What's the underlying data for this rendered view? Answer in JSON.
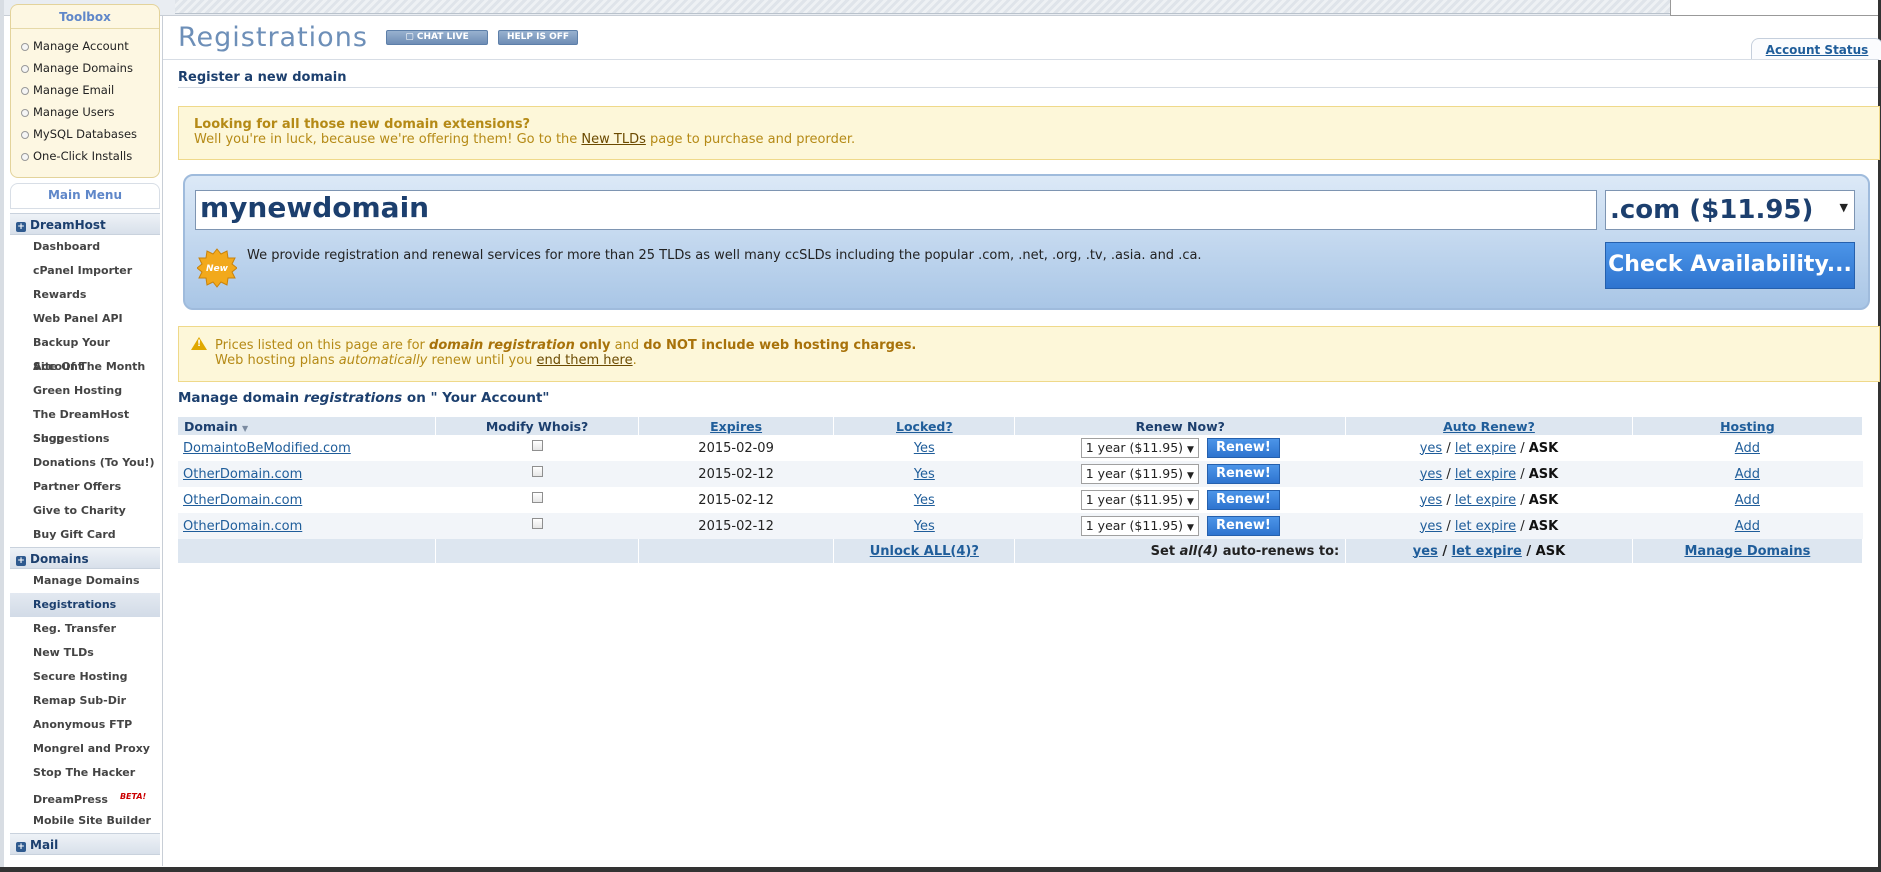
{
  "sidebar": {
    "toolbox_title": "Toolbox",
    "toolbox_items": [
      "Manage Account",
      "Manage Domains",
      "Manage Email",
      "Manage Users",
      "MySQL Databases",
      "One-Click Installs"
    ],
    "main_menu_title": "Main Menu",
    "sections": [
      {
        "title": "DreamHost",
        "items": [
          "Dashboard",
          "cPanel Importer",
          "Rewards",
          "Web Panel API",
          "Backup Your Account",
          "Site Of The Month",
          "Green Hosting",
          "The DreamHost Shop",
          "Suggestions",
          "Donations (To You!)",
          "Partner Offers",
          "Give to Charity",
          "Buy Gift Card"
        ]
      },
      {
        "title": "Domains",
        "items": [
          "Manage Domains",
          "Registrations",
          "Reg. Transfer",
          "New TLDs",
          "Secure Hosting",
          "Remap Sub-Dir",
          "Anonymous FTP",
          "Mongrel and Proxy",
          "Stop The Hacker",
          "DreamPress",
          "Mobile Site Builder"
        ]
      },
      {
        "title": "Mail",
        "items": []
      }
    ],
    "active_item": "Registrations",
    "beta_label": "BETA!"
  },
  "header": {
    "title": "Registrations",
    "chat_label": "CHAT LIVE",
    "help_label": "HELP IS OFF",
    "account_status": "Account Status"
  },
  "register": {
    "heading": "Register a new domain",
    "notice_title": "Looking for all those new domain extensions?",
    "notice_pre": "Well you're in luck, because we're offering them! Go to the ",
    "notice_link": "New TLDs",
    "notice_post": " page to purchase and preorder.",
    "domain_value": "mynewdomain",
    "tld_selected": ".com ($11.95)",
    "new_badge": "New",
    "blurb": "We provide registration and renewal services for more than 25 TLDs as well many ccSLDs including the popular .com, .net, .org, .tv, .asia. and .ca.",
    "check_button": "Check Availability..."
  },
  "pricing_note": {
    "l1_a": "Prices listed on this page are for ",
    "l1_b": "domain registration",
    "l1_c": " only",
    "l1_d": " and ",
    "l1_e": "do NOT include web hosting charges.",
    "l2_a": "Web hosting plans ",
    "l2_b": "automatically",
    "l2_c": " renew until you ",
    "l2_link": "end them here",
    "l2_d": "."
  },
  "manage": {
    "h_a": "Manage domain ",
    "h_b": "registrations",
    "h_c": " on \"  Your  Account\"",
    "columns": [
      "Domain",
      "Modify Whois?",
      "Expires",
      "Locked?",
      "Renew Now?",
      "Auto Renew?",
      "Hosting"
    ],
    "rows": [
      {
        "domain": "DomaintoBeModified.com",
        "expires": "2015-02-09",
        "locked": "Yes",
        "term": "1 year ($11.95)",
        "renew": "Renew!",
        "yes": "yes",
        "let_expire": "let expire",
        "ask": "ASK",
        "hosting": "Add"
      },
      {
        "domain": "OtherDomain.com",
        "expires": "2015-02-12",
        "locked": "Yes",
        "term": "1 year ($11.95)",
        "renew": "Renew!",
        "yes": "yes",
        "let_expire": "let expire",
        "ask": "ASK",
        "hosting": "Add"
      },
      {
        "domain": "OtherDomain.com",
        "expires": "2015-02-12",
        "locked": "Yes",
        "term": "1 year ($11.95)",
        "renew": "Renew!",
        "yes": "yes",
        "let_expire": "let expire",
        "ask": "ASK",
        "hosting": "Add"
      },
      {
        "domain": "OtherDomain.com",
        "expires": "2015-02-12",
        "locked": "Yes",
        "term": "1 year ($11.95)",
        "renew": "Renew!",
        "yes": "yes",
        "let_expire": "let expire",
        "ask": "ASK",
        "hosting": "Add"
      }
    ],
    "footer": {
      "unlock_all": "Unlock ALL(4)?",
      "set_a": "Set ",
      "set_b": "all(4)",
      "set_c": " auto-renews to:",
      "yes": "yes",
      "let_expire": "let expire",
      "ask": "ASK",
      "manage_domains": "Manage Domains"
    }
  }
}
